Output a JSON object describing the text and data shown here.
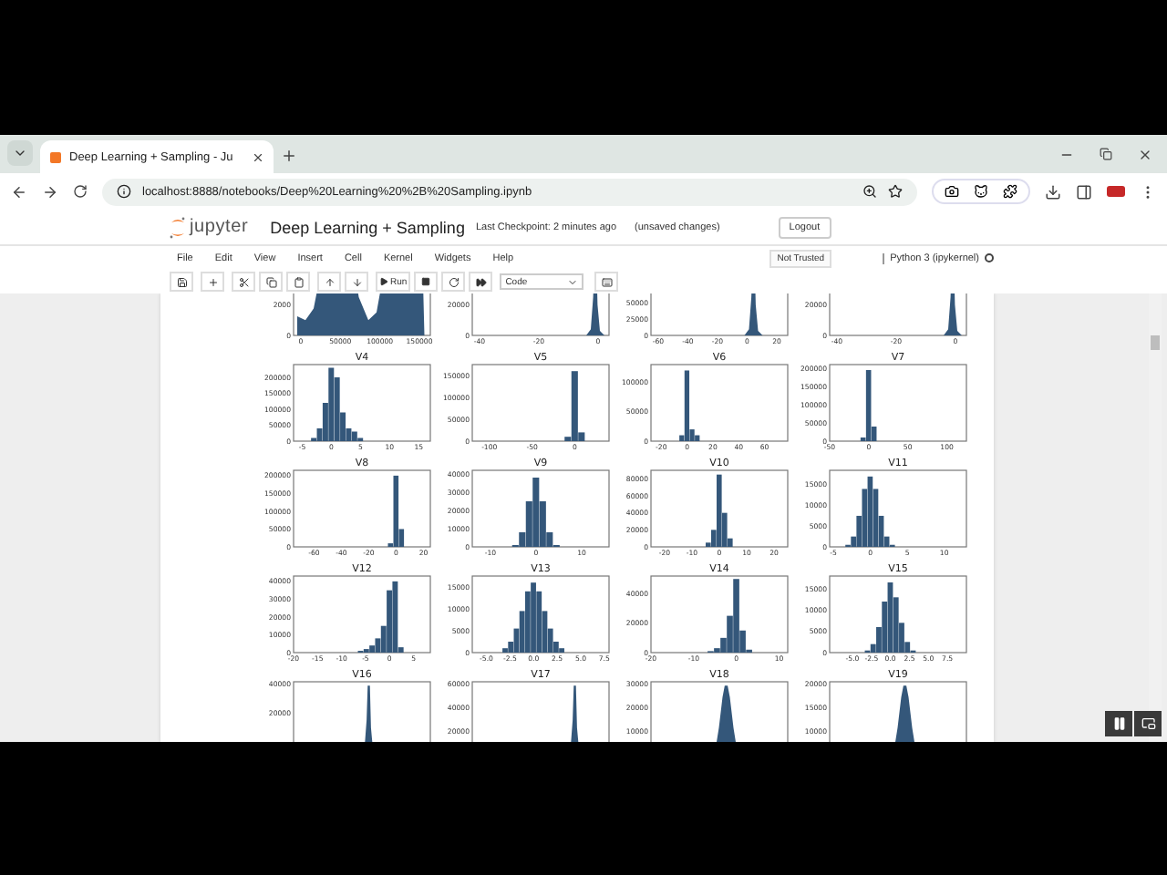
{
  "browser": {
    "tab_title": "Deep Learning + Sampling - Ju",
    "address": "localhost:8888/notebooks/Deep%20Learning%20%2B%20Sampling.ipynb"
  },
  "notebook": {
    "logo": "jupyter",
    "title": "Deep Learning + Sampling",
    "checkpoint": "Last Checkpoint: 2 minutes ago",
    "status": "(unsaved changes)",
    "logout": "Logout",
    "menu": [
      "File",
      "Edit",
      "View",
      "Insert",
      "Cell",
      "Kernel",
      "Widgets",
      "Help"
    ],
    "trust": "Not Trusted",
    "kernel": "Python 3 (ipykernel)",
    "run": "Run",
    "cell_type": "Code"
  },
  "plots": [
    {
      "kind": "bimodal",
      "xticks": [
        "0",
        "50000",
        "100000",
        "150000"
      ],
      "yticks": [
        "2000",
        "0"
      ]
    },
    {
      "kind": "spike-edge",
      "xticks": [
        "-40",
        "-20",
        "0"
      ],
      "yticks": [
        "20000",
        "0"
      ]
    },
    {
      "kind": "spike-right",
      "xticks": [
        "-60",
        "-40",
        "-20",
        "0",
        "20"
      ],
      "yticks": [
        "50000",
        "25000",
        "0"
      ]
    },
    {
      "kind": "spike-edge",
      "xticks": [
        "-40",
        "-20",
        "0"
      ],
      "yticks": [
        "20000",
        "0"
      ]
    },
    {
      "chart_data": {
        "type": "bar",
        "title": "V4",
        "x": [
          -3,
          -2,
          -1,
          0,
          1,
          2,
          3,
          4,
          5
        ],
        "values": [
          10000,
          40000,
          120000,
          230000,
          200000,
          90000,
          40000,
          30000,
          10000
        ],
        "xlim": [
          -6.5,
          17
        ],
        "ylim": [
          0,
          240000
        ],
        "xticks": [
          -5,
          0,
          5,
          10,
          15
        ],
        "yticks": [
          0,
          50000,
          100000,
          150000,
          200000
        ]
      }
    },
    {
      "chart_data": {
        "type": "bar",
        "title": "V5",
        "x": [
          -8,
          0,
          8
        ],
        "values": [
          10000,
          160000,
          20000
        ],
        "xlim": [
          -120,
          40
        ],
        "ylim": [
          0,
          175000
        ],
        "xticks": [
          -100,
          -50,
          0
        ],
        "yticks": [
          0,
          50000,
          100000,
          150000
        ]
      }
    },
    {
      "chart_data": {
        "type": "bar",
        "title": "V6",
        "x": [
          -4,
          0,
          4,
          8
        ],
        "values": [
          10000,
          120000,
          20000,
          10000
        ],
        "xlim": [
          -28,
          78
        ],
        "ylim": [
          0,
          130000
        ],
        "xticks": [
          -20,
          0,
          20,
          40,
          60
        ],
        "yticks": [
          0,
          50000,
          100000
        ]
      }
    },
    {
      "chart_data": {
        "type": "bar",
        "title": "V7",
        "x": [
          -7,
          0,
          7
        ],
        "values": [
          10000,
          195000,
          40000
        ],
        "xlim": [
          -50,
          125
        ],
        "ylim": [
          0,
          210000
        ],
        "xticks": [
          -50,
          0,
          50,
          100
        ],
        "yticks": [
          0,
          50000,
          100000,
          150000,
          200000
        ]
      }
    },
    {
      "chart_data": {
        "type": "bar",
        "title": "V8",
        "x": [
          -4,
          0,
          4
        ],
        "values": [
          10000,
          200000,
          50000
        ],
        "xlim": [
          -75,
          25
        ],
        "ylim": [
          0,
          215000
        ],
        "xticks": [
          -60,
          -40,
          -20,
          0,
          20
        ],
        "yticks": [
          0,
          50000,
          100000,
          150000,
          200000
        ]
      }
    },
    {
      "chart_data": {
        "type": "bar",
        "title": "V9",
        "x": [
          -4.5,
          -3,
          -1.5,
          0,
          1.5,
          3,
          4.5
        ],
        "values": [
          1000,
          8000,
          25000,
          38000,
          25000,
          8000,
          1000
        ],
        "xlim": [
          -14,
          16
        ],
        "ylim": [
          0,
          42000
        ],
        "xticks": [
          -10,
          0,
          10
        ],
        "yticks": [
          0,
          10000,
          20000,
          30000,
          40000
        ]
      }
    },
    {
      "chart_data": {
        "type": "bar",
        "title": "V10",
        "x": [
          -4,
          -2,
          0,
          2,
          4
        ],
        "values": [
          5000,
          20000,
          85000,
          40000,
          10000
        ],
        "xlim": [
          -25,
          25
        ],
        "ylim": [
          0,
          90000
        ],
        "xticks": [
          -20,
          -10,
          0,
          10,
          20
        ],
        "yticks": [
          0,
          20000,
          40000,
          60000,
          80000
        ]
      }
    },
    {
      "chart_data": {
        "type": "bar",
        "title": "V11",
        "x": [
          -3,
          -2.25,
          -1.5,
          -0.75,
          0,
          0.75,
          1.5,
          2.25,
          3
        ],
        "values": [
          500,
          2500,
          7500,
          14000,
          17000,
          14000,
          7500,
          2500,
          500
        ],
        "xlim": [
          -5.5,
          13
        ],
        "ylim": [
          0,
          18500
        ],
        "xticks": [
          -5,
          0,
          5,
          10
        ],
        "yticks": [
          0,
          5000,
          10000,
          15000
        ]
      }
    },
    {
      "chart_data": {
        "type": "bar",
        "title": "V12",
        "x": [
          -6,
          -4.8,
          -3.6,
          -2.4,
          -1.2,
          0,
          1.2,
          2.4
        ],
        "values": [
          1000,
          2000,
          4000,
          8000,
          15000,
          35000,
          40000,
          3000
        ],
        "xlim": [
          -20,
          8.5
        ],
        "ylim": [
          0,
          43000
        ],
        "xticks": [
          -20,
          -15,
          -10,
          -5,
          0,
          5
        ],
        "yticks": [
          0,
          10000,
          20000,
          30000,
          40000
        ]
      }
    },
    {
      "chart_data": {
        "type": "bar",
        "title": "V13",
        "x": [
          -3,
          -2.4,
          -1.8,
          -1.2,
          -0.6,
          0,
          0.6,
          1.2,
          1.8,
          2.4,
          3
        ],
        "values": [
          1000,
          2500,
          5500,
          9500,
          14000,
          16000,
          14000,
          9500,
          5500,
          2500,
          1000
        ],
        "xlim": [
          -6.5,
          8
        ],
        "ylim": [
          0,
          17500
        ],
        "xticks": [
          {
            "value": -5,
            "label": "-5.0"
          },
          {
            "value": -2.5,
            "label": "-2.5"
          },
          {
            "value": 0,
            "label": "0.0"
          },
          {
            "value": 2.5,
            "label": "2.5"
          },
          {
            "value": 5,
            "label": "5.0"
          },
          {
            "value": 7.5,
            "label": "7.5"
          }
        ],
        "yticks": [
          0,
          5000,
          10000,
          15000
        ]
      }
    },
    {
      "chart_data": {
        "type": "bar",
        "title": "V14",
        "x": [
          -6,
          -4.5,
          -3,
          -1.5,
          0,
          1.5,
          3
        ],
        "values": [
          1000,
          3000,
          10000,
          25000,
          50000,
          15000,
          2000
        ],
        "xlim": [
          -20,
          12
        ],
        "ylim": [
          0,
          52000
        ],
        "xticks": [
          -20,
          -10,
          0,
          10
        ],
        "yticks": [
          0,
          20000,
          40000
        ]
      }
    },
    {
      "chart_data": {
        "type": "bar",
        "title": "V15",
        "x": [
          -3,
          -2.25,
          -1.5,
          -0.75,
          0,
          0.75,
          1.5,
          2.25,
          3
        ],
        "values": [
          500,
          2000,
          6000,
          12000,
          16500,
          13000,
          7000,
          2500,
          500
        ],
        "xlim": [
          -8,
          10
        ],
        "ylim": [
          0,
          18000
        ],
        "xticks": [
          {
            "value": -5,
            "label": "-5.0"
          },
          {
            "value": -2.5,
            "label": "-2.5"
          },
          {
            "value": 0,
            "label": "0.0"
          },
          {
            "value": 2.5,
            "label": "2.5"
          },
          {
            "value": 5,
            "label": "5.0"
          },
          {
            "value": 7.5,
            "label": "7.5"
          }
        ],
        "yticks": [
          0,
          5000,
          10000,
          15000
        ]
      }
    },
    {
      "kind": "spike",
      "title": "V16",
      "yticks": [
        "40000",
        "20000"
      ]
    },
    {
      "kind": "spike-right",
      "title": "V17",
      "yticks": [
        "60000",
        "40000",
        "20000"
      ]
    },
    {
      "kind": "bell",
      "title": "V18",
      "yticks": [
        "30000",
        "20000",
        "10000"
      ]
    },
    {
      "kind": "bell",
      "title": "V19",
      "yticks": [
        "20000",
        "15000",
        "10000"
      ]
    }
  ]
}
